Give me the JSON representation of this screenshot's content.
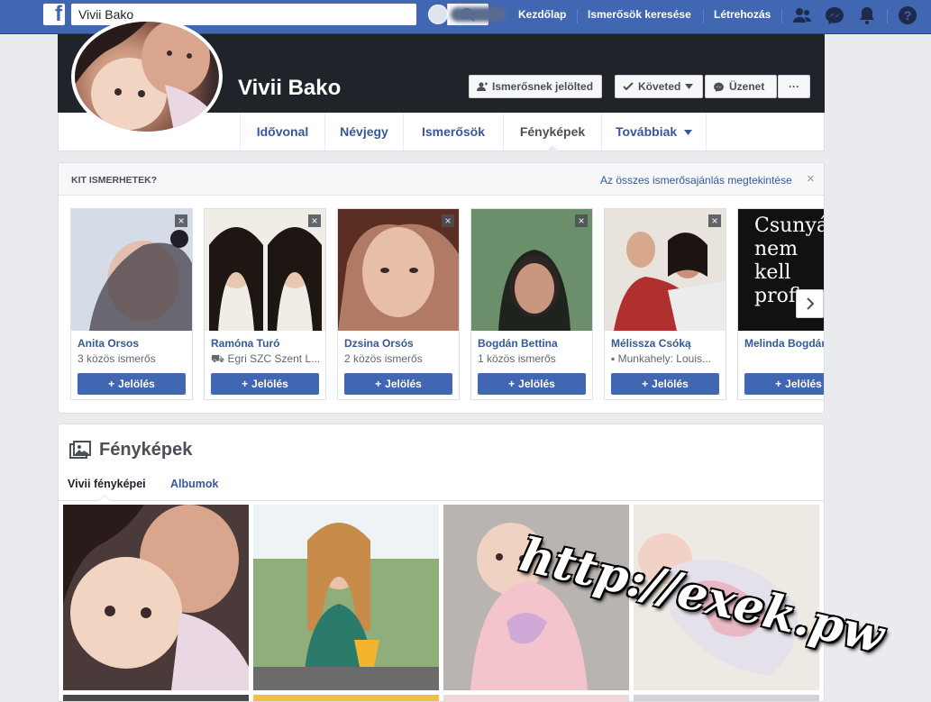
{
  "topbar": {
    "search_value": "Vivii Bako",
    "nav": [
      "Kezdőlap",
      "Ismerősök keresése",
      "Létrehozás"
    ],
    "icons": [
      "friend-requests-icon",
      "messenger-icon",
      "notifications-icon",
      "help-icon"
    ]
  },
  "profile": {
    "name": "Vivii Bako",
    "buttons": {
      "add_friend": "Ismerősnek jelölted",
      "follow": "Követed",
      "message": "Üzenet",
      "more": "···"
    },
    "tabs": [
      "Idővonal",
      "Névjegy",
      "Ismerősök",
      "Fényképek",
      "Továbbiak"
    ]
  },
  "pymk": {
    "title": "KIT ISMERHETEK?",
    "see_all": "Az összes ismerősajánlás megtekintése",
    "close": "×",
    "people": [
      {
        "name": "Anita Orsos",
        "sub": "3 közös ismerős",
        "button": "Jelölés",
        "sub_icon": ""
      },
      {
        "name": "Ramóna Turó",
        "sub": "Egri SZC Szent L...",
        "button": "Jelölés",
        "sub_icon": "school-icon"
      },
      {
        "name": "Dzsina Orsós",
        "sub": "2 közös ismerős",
        "button": "Jelölés",
        "sub_icon": ""
      },
      {
        "name": "Bogdán Bettina",
        "sub": "1 közös ismerős",
        "button": "Jelölés",
        "sub_icon": ""
      },
      {
        "name": "Mélissza Csóką",
        "sub": "Munkahely: Louis...",
        "button": "Jelölés",
        "sub_icon": "work-icon"
      },
      {
        "name": "Melinda Bogdán",
        "sub": "",
        "button": "Jelölés",
        "sub_icon": ""
      }
    ],
    "card6_text": "Csunyá\nnem\nkell\nprofi"
  },
  "photos": {
    "title": "Fényképek",
    "subtabs": [
      "Vivii fényképei",
      "Albumok"
    ]
  },
  "watermark": "http://exek.pw"
}
